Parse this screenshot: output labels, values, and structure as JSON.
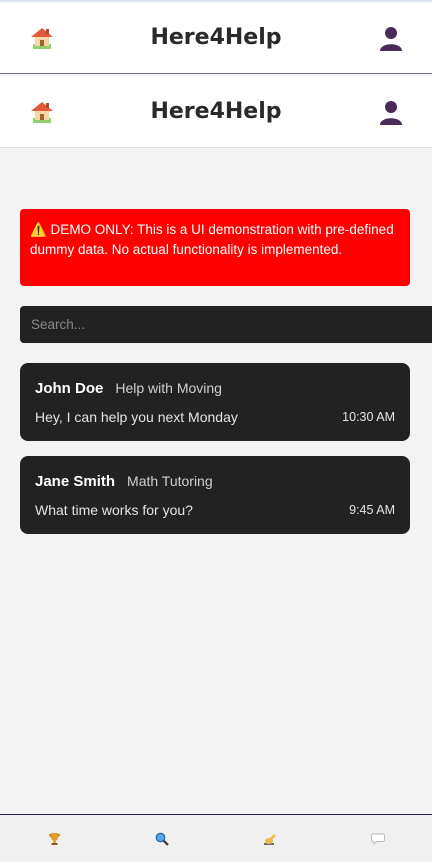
{
  "header": {
    "title": "Here4Help",
    "home_icon": "home-icon",
    "profile_icon": "user-profile-icon"
  },
  "alert": {
    "icon": "warning-icon",
    "text": "⚠️ DEMO ONLY: This is a UI demonstration with pre-defined dummy data. No actual functionality is implemented.",
    "color": "#ff0000"
  },
  "search": {
    "placeholder": "Search...",
    "value": ""
  },
  "chats": [
    {
      "name": "John Doe",
      "topic": "Help with Moving",
      "message": "Hey, I can help you next Monday",
      "time": "10:30 AM"
    },
    {
      "name": "Jane Smith",
      "topic": "Math Tutoring",
      "message": "What time works for you?",
      "time": "9:45 AM"
    }
  ],
  "bottom_nav": {
    "items": [
      {
        "icon": "trophy-icon"
      },
      {
        "icon": "search-icon"
      },
      {
        "icon": "writing-hand-icon"
      },
      {
        "icon": "chat-bubble-icon"
      }
    ]
  },
  "colors": {
    "background": "#f3f3f3",
    "card": "#222222",
    "alert": "#ff0000",
    "title": "#2a2a2a",
    "nav_border": "#1e2250"
  }
}
